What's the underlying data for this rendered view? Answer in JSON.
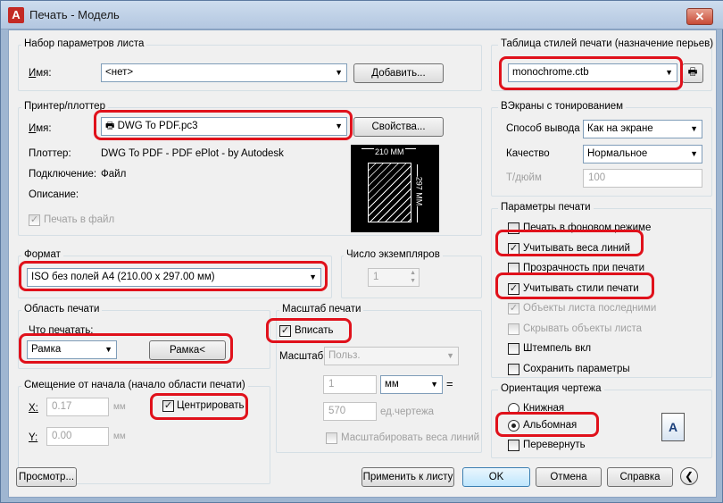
{
  "window": {
    "title": "Печать - Модель",
    "logo": "A"
  },
  "page_setup": {
    "title": "Набор параметров листа",
    "name_label": "Имя:",
    "name_value": "<нет>",
    "add_button": "Добавить..."
  },
  "printer": {
    "title": "Принтер/плоттер",
    "name_label": "Имя:",
    "name_value": "DWG To PDF.pc3",
    "props_button": "Свойства...",
    "plotter_label": "Плоттер:",
    "plotter_value": "DWG To PDF - PDF ePlot - by Autodesk",
    "connection_label": "Подключение:",
    "connection_value": "Файл",
    "description_label": "Описание:",
    "print_to_file": "Печать в файл",
    "preview_width": "210 MM",
    "preview_height": "297 MM"
  },
  "format": {
    "title": "Формат",
    "value": "ISO без полей A4 (210.00 x 297.00 мм)"
  },
  "copies": {
    "title": "Число экземпляров",
    "value": "1"
  },
  "plot_area": {
    "title": "Область печати",
    "what_label": "Что печатать:",
    "what_value": "Рамка",
    "frame_button": "Рамка<"
  },
  "offset": {
    "title": "Смещение от начала (начало области печати)",
    "x_label": "X:",
    "x_value": "0.17",
    "x_unit": "мм",
    "y_label": "Y:",
    "y_value": "0.00",
    "y_unit": "мм",
    "center_label": "Центрировать"
  },
  "scale": {
    "title": "Масштаб печати",
    "fit_label": "Вписать",
    "scale_label": "Масштаб:",
    "scale_value": "Польз.",
    "value1": "1",
    "unit1": "мм",
    "equals": "=",
    "value2": "570",
    "unit2": "ед.чертежа",
    "lineweights_label": "Масштабировать веса линий"
  },
  "style_table": {
    "title": "Таблица стилей печати (назначение перьев)",
    "value": "monochrome.ctb"
  },
  "shaded": {
    "title": "ВЭкраны с тонированием",
    "output_label": "Способ вывода",
    "output_value": "Как на экране",
    "quality_label": "Качество",
    "quality_value": "Нормальное",
    "dpi_label": "Т/дюйм",
    "dpi_value": "100"
  },
  "options": {
    "title": "Параметры печати",
    "items": [
      {
        "label": "Печать в фоновом режиме",
        "checked": false
      },
      {
        "label": "Учитывать веса линий",
        "checked": true
      },
      {
        "label": "Прозрачность при печати",
        "checked": false
      },
      {
        "label": "Учитывать стили печати",
        "checked": true
      },
      {
        "label": "Объекты листа последними",
        "checked": true
      },
      {
        "label": "Скрывать объекты листа",
        "checked": false
      },
      {
        "label": "Штемпель вкл",
        "checked": false
      },
      {
        "label": "Сохранить параметры",
        "checked": false
      }
    ]
  },
  "orientation": {
    "title": "Ориентация чертежа",
    "portrait": "Книжная",
    "landscape": "Альбомная",
    "upside_down": "Перевернуть",
    "selected": "landscape"
  },
  "buttons": {
    "preview": "Просмотр...",
    "apply": "Применить к листу",
    "ok": "OK",
    "cancel": "Отмена",
    "help": "Справка"
  },
  "checkmark": "✓",
  "colors": {
    "highlight": "#e0111b",
    "window_frame": "#9fb6d1"
  }
}
